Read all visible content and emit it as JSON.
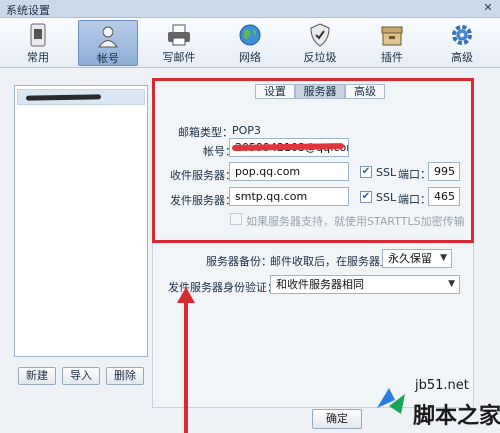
{
  "window": {
    "title": "系统设置",
    "close": "✕"
  },
  "toolbar": {
    "items": [
      {
        "label": "常用",
        "icon": "sim-card-icon"
      },
      {
        "label": "帐号",
        "icon": "user-icon",
        "active": true
      },
      {
        "label": "写邮件",
        "icon": "printer-icon"
      },
      {
        "label": "网络",
        "icon": "globe-icon"
      },
      {
        "label": "反垃圾",
        "icon": "shield-check-icon"
      },
      {
        "label": "插件",
        "icon": "box-icon"
      },
      {
        "label": "高级",
        "icon": "gear-icon"
      }
    ]
  },
  "left": {
    "buttons": {
      "new": "新建",
      "import": "导入",
      "delete": "删除"
    }
  },
  "tabs": [
    "设置",
    "服务器",
    "高级"
  ],
  "server": {
    "mailbox_type_label": "邮箱类型：",
    "mailbox_type_value": "POP3",
    "account_label": "帐号：",
    "account_value": "2059942103@qq.com",
    "incoming_label": "收件服务器：",
    "incoming_value": "pop.qq.com",
    "outgoing_label": "发件服务器：",
    "outgoing_value": "smtp.qq.com",
    "ssl_label": "SSL",
    "port_label": "端口：",
    "incoming_port": "995",
    "outgoing_port": "465",
    "starttls_label": "如果服务器支持，就使用STARTTLS加密传输"
  },
  "backup": {
    "label": "服务器备份：",
    "desc": "邮件收取后，在服务器上",
    "value": "永久保留"
  },
  "auth": {
    "label": "发件服务器身份验证：",
    "value": "和收件服务器相同"
  },
  "footer": {
    "ok": "确定"
  },
  "watermark": {
    "url": "jb51.net",
    "name": "脚本之家"
  },
  "colors": {
    "highlight": "#d62a31",
    "active_tab": "#c6d3e1"
  }
}
